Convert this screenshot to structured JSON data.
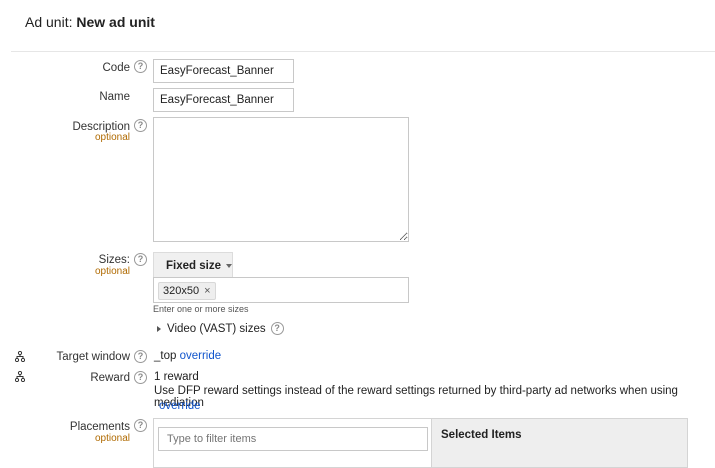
{
  "header": {
    "prefix": "Ad unit: ",
    "title": "New ad unit"
  },
  "form": {
    "code": {
      "label": "Code",
      "value": "EasyForecast_Banner"
    },
    "name": {
      "label": "Name",
      "value": "EasyForecast_Banner"
    },
    "description": {
      "label": "Description",
      "optional": "optional",
      "value": ""
    },
    "sizes": {
      "label": "Sizes:",
      "optional": "optional",
      "mode_button": "Fixed size",
      "chips": [
        "320x50"
      ],
      "chip_remove": "×",
      "hint": "Enter one or more sizes",
      "vast_toggle": "Video (VAST) sizes"
    },
    "target_window": {
      "label": "Target window",
      "value": "_top",
      "override": "override"
    },
    "reward": {
      "label": "Reward",
      "value": "1 reward",
      "description": "Use DFP reward settings instead of the reward settings returned by third-party ad networks when using mediation",
      "override": "override"
    },
    "placements": {
      "label": "Placements",
      "optional": "optional",
      "filter_placeholder": "Type to filter items",
      "selected_title": "Selected Items"
    }
  },
  "help_glyph": "?",
  "colors": {
    "link": "#1155cc",
    "optional": "#b06a00"
  }
}
